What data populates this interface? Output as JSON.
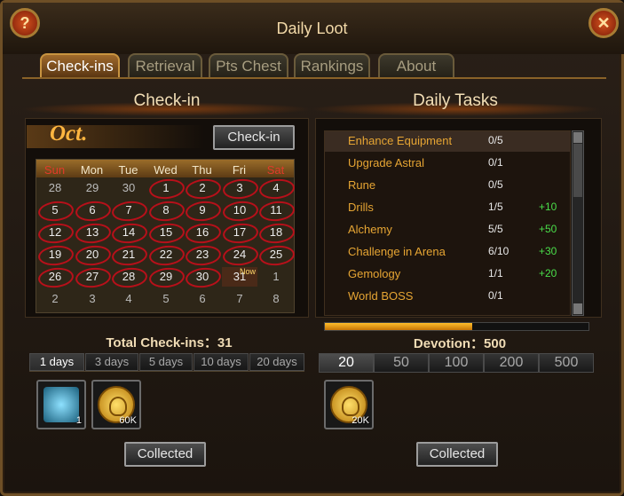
{
  "window": {
    "title": "Daily Loot",
    "help_icon": "?",
    "close_icon": "✕"
  },
  "tabs": [
    "Check-ins",
    "Retrieval",
    "Pts Chest",
    "Rankings",
    "About"
  ],
  "checkin": {
    "section_title": "Check-in",
    "month": "Oct.",
    "checkin_button": "Check-in",
    "weekdays": [
      "Sun",
      "Mon",
      "Tue",
      "Wed",
      "Thu",
      "Fri",
      "Sat"
    ],
    "weeks": [
      [
        "28",
        "29",
        "30",
        "1",
        "2",
        "3",
        "4"
      ],
      [
        "5",
        "6",
        "7",
        "8",
        "9",
        "10",
        "11"
      ],
      [
        "12",
        "13",
        "14",
        "15",
        "16",
        "17",
        "18"
      ],
      [
        "19",
        "20",
        "21",
        "22",
        "23",
        "24",
        "25"
      ],
      [
        "26",
        "27",
        "28",
        "29",
        "30",
        "31",
        "1"
      ],
      [
        "2",
        "3",
        "4",
        "5",
        "6",
        "7",
        "8"
      ]
    ],
    "now_label": "Now",
    "total_label": "Total Check-ins：31",
    "day_tabs": [
      "1 days",
      "3 days",
      "5 days",
      "10 days",
      "20 days"
    ],
    "reward_items": [
      {
        "icon": "fishing-rod-icon",
        "qty": "1"
      },
      {
        "icon": "gold-coin-icon",
        "qty": "60K"
      }
    ],
    "collected_button": "Collected"
  },
  "tasks": {
    "section_title": "Daily Tasks",
    "items": [
      {
        "name": "Enhance Equipment",
        "count": "0/5",
        "reward": ""
      },
      {
        "name": "Upgrade Astral",
        "count": "0/1",
        "reward": ""
      },
      {
        "name": "Rune",
        "count": "0/5",
        "reward": ""
      },
      {
        "name": "Drills",
        "count": "1/5",
        "reward": "+10"
      },
      {
        "name": "Alchemy",
        "count": "5/5",
        "reward": "+50"
      },
      {
        "name": "Challenge in Arena",
        "count": "6/10",
        "reward": "+30"
      },
      {
        "name": "Gemology",
        "count": "1/1",
        "reward": "+20"
      },
      {
        "name": "World BOSS",
        "count": "0/1",
        "reward": ""
      }
    ],
    "devotion_progress": 0.56,
    "devotion_label": "Devotion：500",
    "devotion_tabs": [
      "20",
      "50",
      "100",
      "200",
      "500"
    ],
    "reward_items": [
      {
        "icon": "gold-coin-icon",
        "qty": "20K"
      }
    ],
    "collected_button": "Collected"
  },
  "colors": {
    "accent": "#e6a533",
    "gold": "#c89440",
    "reward_green": "#4ade4a",
    "circle_red": "#b8101a"
  }
}
